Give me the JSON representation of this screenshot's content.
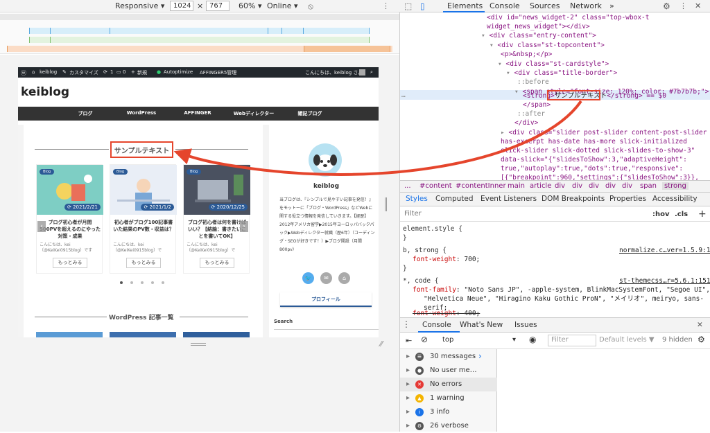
{
  "device_toolbar": {
    "mode": "Responsive",
    "width": "1024",
    "height": "767",
    "times": "×",
    "zoom": "60%",
    "network": "Online"
  },
  "wp_admin_bar": {
    "site": "keiblog",
    "customize": "カスタマイズ",
    "updates": "1",
    "comments": "0",
    "new": "新規",
    "autoptimize": "Autoptimize",
    "affinger": "AFFINGER5管理",
    "greeting": "こんにちは、keiblog さん"
  },
  "site": {
    "title": "keiblog",
    "nav": [
      "ブログ",
      "WordPress",
      "AFFINGER",
      "Webディレクター",
      "雑記ブログ"
    ]
  },
  "section_title": "サンプルテキスト",
  "cards": [
    {
      "badge": "Blog",
      "date": "2021/2/21",
      "title": "ブログ初心者が月間500PVを超えるのにやった対策・成果",
      "excerpt": "こんにちは、kei（@KeiKei0915blog）です",
      "more": "もっとみる"
    },
    {
      "badge": "Blog",
      "date": "2021/1/2",
      "title": "初心者がブログ100記事書いた結果のPV数・収益は？",
      "excerpt": "こんにちは、kei（@KeiKei0915blog）で",
      "more": "もっとみる"
    },
    {
      "badge": "Blog",
      "date": "2020/12/25",
      "title": "ブログ初心者は何を書けばいい？【結論：書きたいことを書いてOK】",
      "excerpt": "こんにちは、kei（@KeiKei0915blog）で",
      "more": "もっとみる"
    }
  ],
  "wp_section_title": "WordPress 記事一覧",
  "sidebar": {
    "name": "keiblog",
    "intro": "当ブログは、『シンプルで見やすい記事を発信！』をモットーに「ブログ・WordPress」などWebに関する役立つ情報を発信していきます。【経歴】2012年アメリカ留学▶2015年ヨーロッパバックパック▶Webディレクター就職（歴6年）（コーディング・SEOが好きです！）▶ブログ開設（月間800pv）",
    "profile_button": "プロフィール",
    "search_label": "Search"
  },
  "devtools": {
    "tabs": [
      "Elements",
      "Console",
      "Sources",
      "Network"
    ],
    "more": "»",
    "dom": {
      "l1a": "<div id=\"news_widget-2\" class=\"top-wbox-t",
      "l1b": "widget_news_widget\"></div>",
      "l2": "<div class=\"entry-content\">",
      "l3": "<div class=\"st-topcontent\">",
      "l4": "<p>&nbsp;</p>",
      "l5": "<div class=\"st-cardstyle\">",
      "l6": "<div class=\"title-border\">",
      "l7": "::before",
      "l8": "<span style=\"font-size: 120%; color: #7b7b7b;\">",
      "l9a": "<strong>",
      "l9b": "サンプルテキスト",
      "l9c": "</strong> == $0",
      "l10": "</span>",
      "l11": "::after",
      "l12": "</div>",
      "l13": "<div class=\"slider post-slider content-post-slider",
      "l14": "has-excerpt has-date has-more slick-initialized",
      "l15": "slick-slider slick-dotted slick-slides-to-show-3\"",
      "l16": "data-slick=\"{\"slidesToShow\":3,\"adaptiveHeight\":",
      "l17": "true,\"autoplay\":true,\"dots\":true,\"responsive\":",
      "l18": "[{\"breakpoint\":960,\"settings\":{\"slidesToShow\":3}},"
    },
    "breadcrumb": [
      "...",
      "#content",
      "#contentInner",
      "main",
      "article",
      "div",
      "div",
      "div",
      "div",
      "div",
      "span",
      "strong"
    ],
    "style_tabs": [
      "Styles",
      "Computed",
      "Event Listeners",
      "DOM Breakpoints",
      "Properties",
      "Accessibility"
    ],
    "filter_placeholder": "Filter",
    "hov": ":hov",
    "cls": ".cls",
    "styles": {
      "r1": "element.style {",
      "r1e": "}",
      "r2": "b, strong {",
      "r2src": "normalize.c…ver=1.5.9:1",
      "r2p": "font-weight",
      "r2v": "700;",
      "r2e": "}",
      "r3": "*, code {",
      "r3src": "st-themecss…r=5.6.1:151",
      "r3p": "font-family",
      "r3v1": "\"Noto Sans JP\", -apple-system, BlinkMacSystemFont, \"Segoe UI\",",
      "r3v2": "\"Helvetica Neue\", \"Hiragino Kaku Gothic ProN\", \"メイリオ\", meiryo, sans-",
      "r3v3": "serif;",
      "r3p2": "font-weight",
      "r3v4": "400;"
    },
    "console_tabs": [
      "Console",
      "What's New",
      "Issues"
    ],
    "console_context": "top",
    "console_filter": "Filter",
    "levels": "Default levels ▼",
    "hidden": "9 hidden",
    "console_items": [
      {
        "label": "30 messages",
        "icon": "list-icon",
        "color": "#555"
      },
      {
        "label": "No user me…",
        "icon": "user-icon",
        "color": "#555"
      },
      {
        "label": "No errors",
        "icon": "error-icon",
        "color": "#e53935"
      },
      {
        "label": "1 warning",
        "icon": "warning-icon",
        "color": "#f4b400"
      },
      {
        "label": "3 info",
        "icon": "info-icon",
        "color": "#1a73e8"
      },
      {
        "label": "26 verbose",
        "icon": "verbose-icon",
        "color": "#555"
      }
    ],
    "prompt": "›"
  },
  "colors": {
    "accent_red": "#e5452c",
    "wp_blue": "#2b5a96",
    "devtools_blue": "#1a73e8"
  }
}
